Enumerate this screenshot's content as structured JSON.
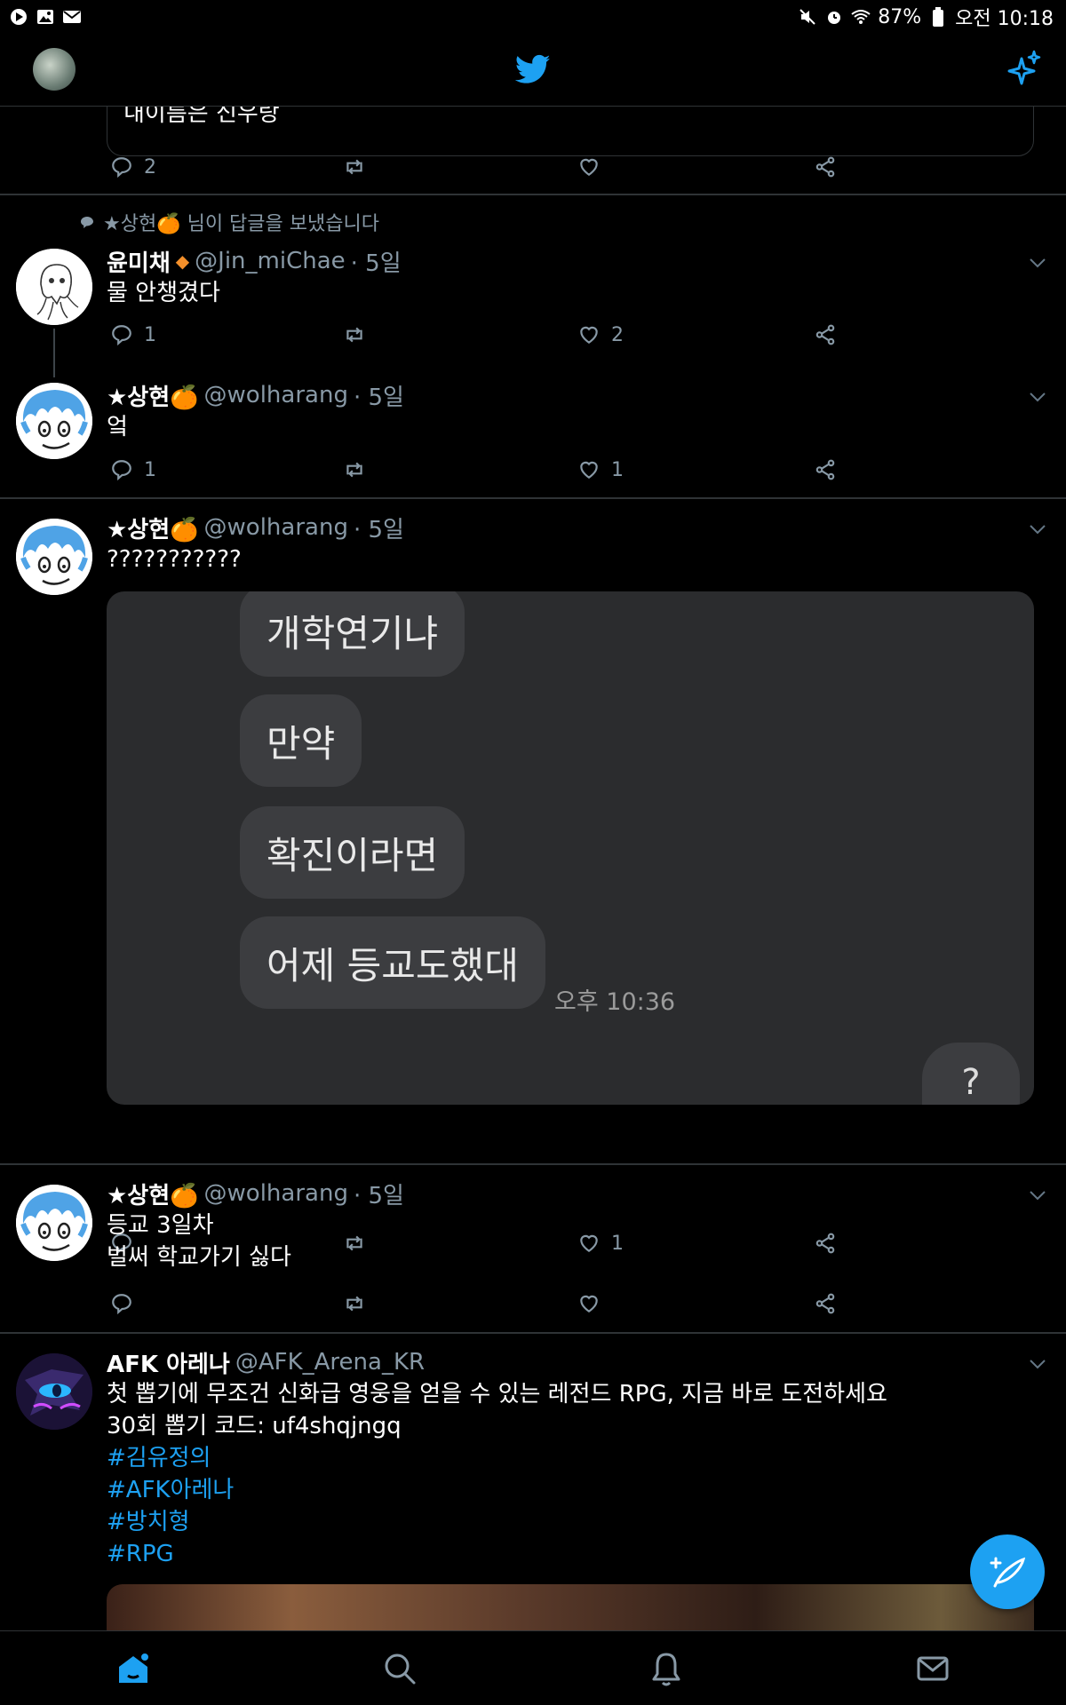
{
  "statusbar": {
    "battery": "87%",
    "time": "오전 10:18"
  },
  "topbar": {
    "logo": "twitter-bird-icon",
    "right_icon": "sparkle-icon"
  },
  "tweets": [
    {
      "quoted_text": "내이름은 신우랑",
      "reply_count": "2",
      "retweet_count": "",
      "like_count": ""
    },
    {
      "context": "★상현🍊 님이 답글을 보냈습니다",
      "name": "윤미채",
      "name_badge": "◆",
      "handle": "@Jin_miChae",
      "time": "· 5일",
      "text": "물 안챙겼다",
      "reply_count": "1",
      "retweet_count": "",
      "like_count": "2"
    },
    {
      "name": "★상현🍊",
      "handle": "@wolharang",
      "time": "· 5일",
      "text": "엌",
      "reply_count": "1",
      "retweet_count": "",
      "like_count": "1"
    },
    {
      "name": "★상현🍊",
      "handle": "@wolharang",
      "time": "· 5일",
      "text": "???????????",
      "media": {
        "bubbles": [
          "개학연기냐",
          "만약",
          "확진이라면",
          "어제 등교도했대"
        ],
        "timestamp": "오후 10:36",
        "reply_bubble": "?"
      },
      "reply_count": "",
      "retweet_count": "",
      "like_count": "1"
    },
    {
      "name": "★상현🍊",
      "handle": "@wolharang",
      "time": "· 5일",
      "text_line1": "등교 3일차",
      "text_line2": "벌써 학교가기 싫다",
      "reply_count": "",
      "retweet_count": "",
      "like_count": ""
    },
    {
      "name": "AFK 아레나",
      "handle": "@AFK_Arena_KR",
      "text_line1": "첫 뽑기에 무조건 신화급 영웅을 얻을 수 있는 레전드 RPG, 지금 바로 도전하세요",
      "text_line2": "30회 뽑기 코드: uf4shqjngq",
      "hashtags": [
        "#김유정의",
        "#AFK아레나",
        "#방치형",
        "#RPG"
      ]
    }
  ],
  "colors": {
    "accent": "#1da1f2",
    "muted": "#8899a6",
    "background": "#000000",
    "divider": "#2f3336"
  },
  "bottomnav": [
    "home-icon",
    "search-icon",
    "notifications-icon",
    "messages-icon"
  ]
}
